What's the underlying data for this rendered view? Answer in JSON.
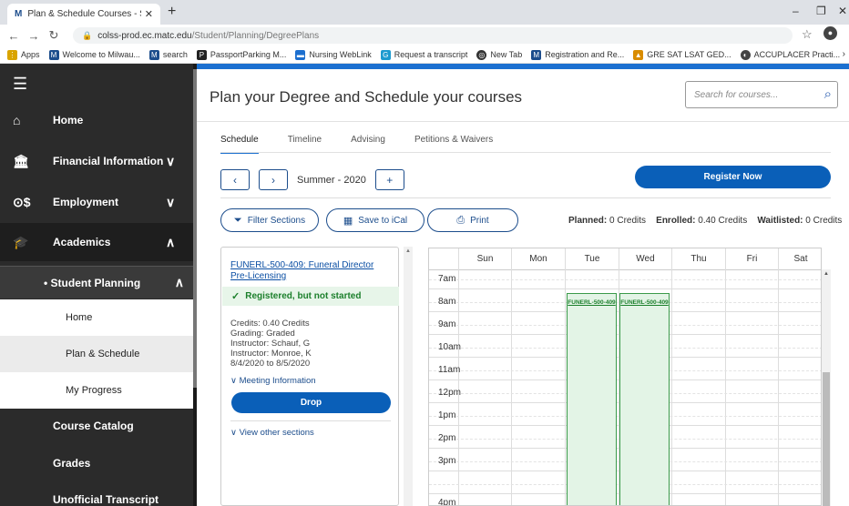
{
  "browser": {
    "tab_title": "Plan & Schedule Courses - Self-S",
    "url_host": "colss-prod.ec.matc.edu",
    "url_path": "/Student/Planning/DegreePlans",
    "bookmarks": [
      {
        "label": "Apps",
        "color": "#d9a400"
      },
      {
        "label": "Welcome to Milwau...",
        "color": "#1c4d8c"
      },
      {
        "label": "search",
        "color": "#1c4d8c"
      },
      {
        "label": "PassportParking M...",
        "color": "#222222"
      },
      {
        "label": "Nursing WebLink",
        "color": "#1c6fcf"
      },
      {
        "label": "Request a transcript",
        "color": "#1c9acf"
      },
      {
        "label": "New Tab",
        "color": "#333333"
      },
      {
        "label": "Registration and Re...",
        "color": "#1c4d8c"
      },
      {
        "label": "GRE SAT LSAT GED...",
        "color": "#d98c00"
      },
      {
        "label": "ACCUPLACER Practi...",
        "color": "#444444"
      }
    ]
  },
  "sidebar": {
    "items": [
      {
        "label": "Home",
        "icon": "home-icon"
      },
      {
        "label": "Financial Information",
        "icon": "bank-icon"
      },
      {
        "label": "Employment",
        "icon": "money-icon"
      },
      {
        "label": "Academics",
        "icon": "graduation-cap-icon"
      }
    ],
    "student_planning": "• Student Planning",
    "sub_items": [
      "Home",
      "Plan & Schedule",
      "My Progress"
    ],
    "bottom_items": [
      "Course Catalog",
      "Grades",
      "Unofficial Transcript"
    ]
  },
  "header": {
    "title": "Plan your Degree and Schedule your courses",
    "search_placeholder": "Search for courses..."
  },
  "tabs": [
    "Schedule",
    "Timeline",
    "Advising",
    "Petitions & Waivers"
  ],
  "term": {
    "label": "Summer - 2020",
    "register_label": "Register Now"
  },
  "actions": {
    "filter": "Filter Sections",
    "ical": "Save to iCal",
    "print": "Print"
  },
  "credits": {
    "planned_label": "Planned:",
    "planned_value": "0 Credits",
    "enrolled_label": "Enrolled:",
    "enrolled_value": "0.40 Credits",
    "waitlisted_label": "Waitlisted:",
    "waitlisted_value": "0 Credits"
  },
  "course": {
    "title": "FUNERL-500-409: Funeral Director Pre-Licensing",
    "status": "Registered, but not started",
    "credits": "Credits: 0.40 Credits",
    "grading": "Grading: Graded",
    "instructor1": "Instructor: Schauf, G",
    "instructor2": "Instructor: Monroe, K",
    "dates": "8/4/2020 to 8/5/2020",
    "meeting_label": "Meeting Information",
    "drop_label": "Drop",
    "other_label": "View other sections"
  },
  "calendar": {
    "days": [
      "Sun",
      "Mon",
      "Tue",
      "Wed",
      "Thu",
      "Fri",
      "Sat"
    ],
    "hours": [
      "7am",
      "8am",
      "9am",
      "10am",
      "11am",
      "12pm",
      "1pm",
      "2pm",
      "3pm",
      "4pm"
    ],
    "events": [
      {
        "day": "Tue",
        "label": "FUNERL-500-409"
      },
      {
        "day": "Wed",
        "label": "FUNERL-500-409"
      }
    ]
  }
}
